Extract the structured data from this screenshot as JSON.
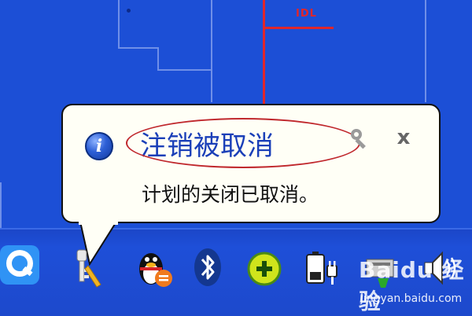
{
  "map": {
    "label": "IDL"
  },
  "notification": {
    "title": "注销被取消",
    "message": "计划的关闭已取消。",
    "close_label": "x"
  },
  "tray_icons": [
    {
      "name": "qq-browser-icon"
    },
    {
      "name": "keys-icon"
    },
    {
      "name": "qq-penguin-icon"
    },
    {
      "name": "bluetooth-icon"
    },
    {
      "name": "add-green-icon"
    },
    {
      "name": "battery-plug-icon"
    },
    {
      "name": "network-icon"
    },
    {
      "name": "volume-icon"
    }
  ],
  "watermark": {
    "brand": "Baidu 经验",
    "url": "jingyan.baidu.com"
  },
  "colors": {
    "desktop": "#1c4fd6",
    "accent_red": "#e0262b",
    "title_blue": "#1a3fb8",
    "balloon_bg": "#fffff6"
  }
}
